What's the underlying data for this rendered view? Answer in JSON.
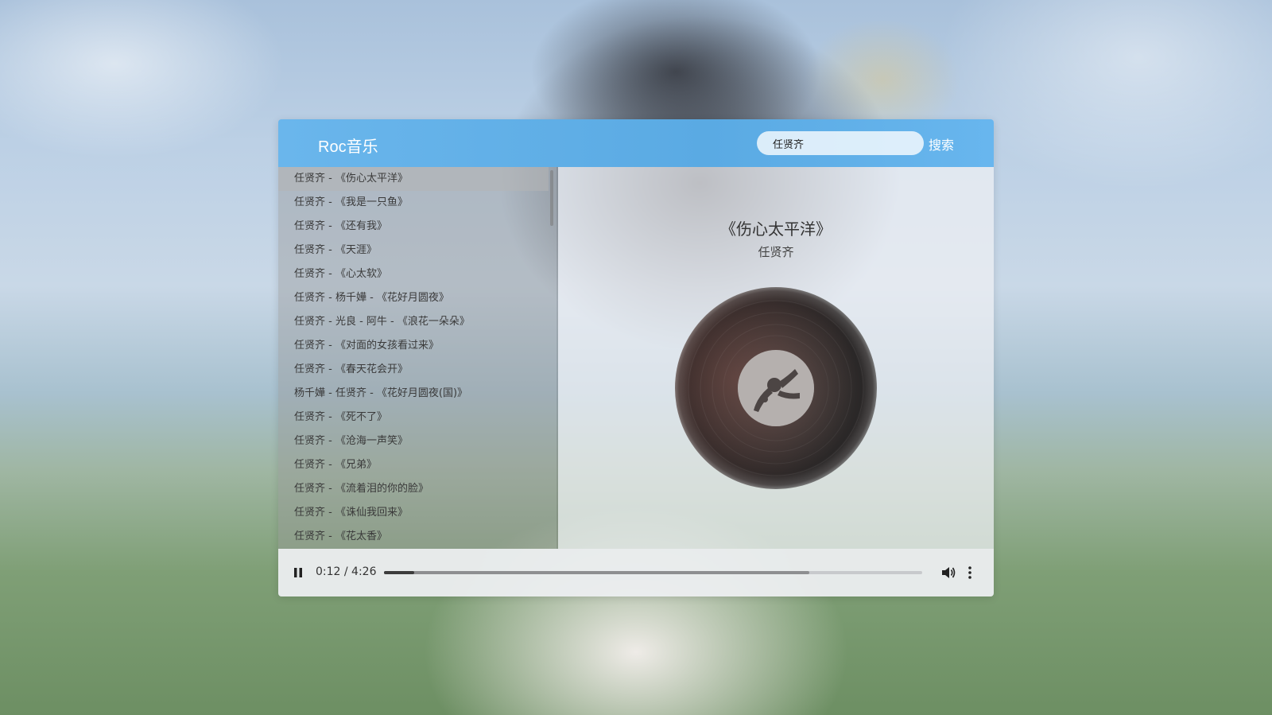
{
  "app": {
    "title": "Roc音乐"
  },
  "search": {
    "value": "任贤齐",
    "button_label": "搜索"
  },
  "playlist": [
    {
      "label": "任贤齐 - 《伤心太平洋》",
      "active": true
    },
    {
      "label": "任贤齐 - 《我是一只鱼》"
    },
    {
      "label": "任贤齐 - 《还有我》"
    },
    {
      "label": "任贤齐 - 《天涯》"
    },
    {
      "label": "任贤齐 - 《心太软》"
    },
    {
      "label": "任贤齐 - 杨千嬅 - 《花好月圆夜》"
    },
    {
      "label": "任贤齐 - 光良 - 阿牛 - 《浪花一朵朵》"
    },
    {
      "label": "任贤齐 - 《对面的女孩看过来》"
    },
    {
      "label": "任贤齐 - 《春天花会开》"
    },
    {
      "label": "杨千嬅 - 任贤齐 - 《花好月圆夜(国)》"
    },
    {
      "label": "任贤齐 - 《死不了》"
    },
    {
      "label": "任贤齐 - 《沧海一声笑》"
    },
    {
      "label": "任贤齐 - 《兄弟》"
    },
    {
      "label": "任贤齐 - 《流着泪的你的脸》"
    },
    {
      "label": "任贤齐 - 《诛仙我回来》"
    },
    {
      "label": "任贤齐 - 《花太香》"
    }
  ],
  "now_playing": {
    "title": "《伤心太平洋》",
    "artist": "任贤齐",
    "disc_icon": "vinyl-record-icon"
  },
  "controls": {
    "time_display": "0:12 / 4:26",
    "progress_fraction": 0.056,
    "buffered_fraction": 0.79,
    "play_state_icon": "pause-icon",
    "volume_icon": "volume-icon",
    "more_icon": "more-vertical-icon"
  },
  "colors": {
    "header_bg": "#5aaae3",
    "header_text": "#ffffff",
    "progress_fill": "#3c3c3c"
  }
}
